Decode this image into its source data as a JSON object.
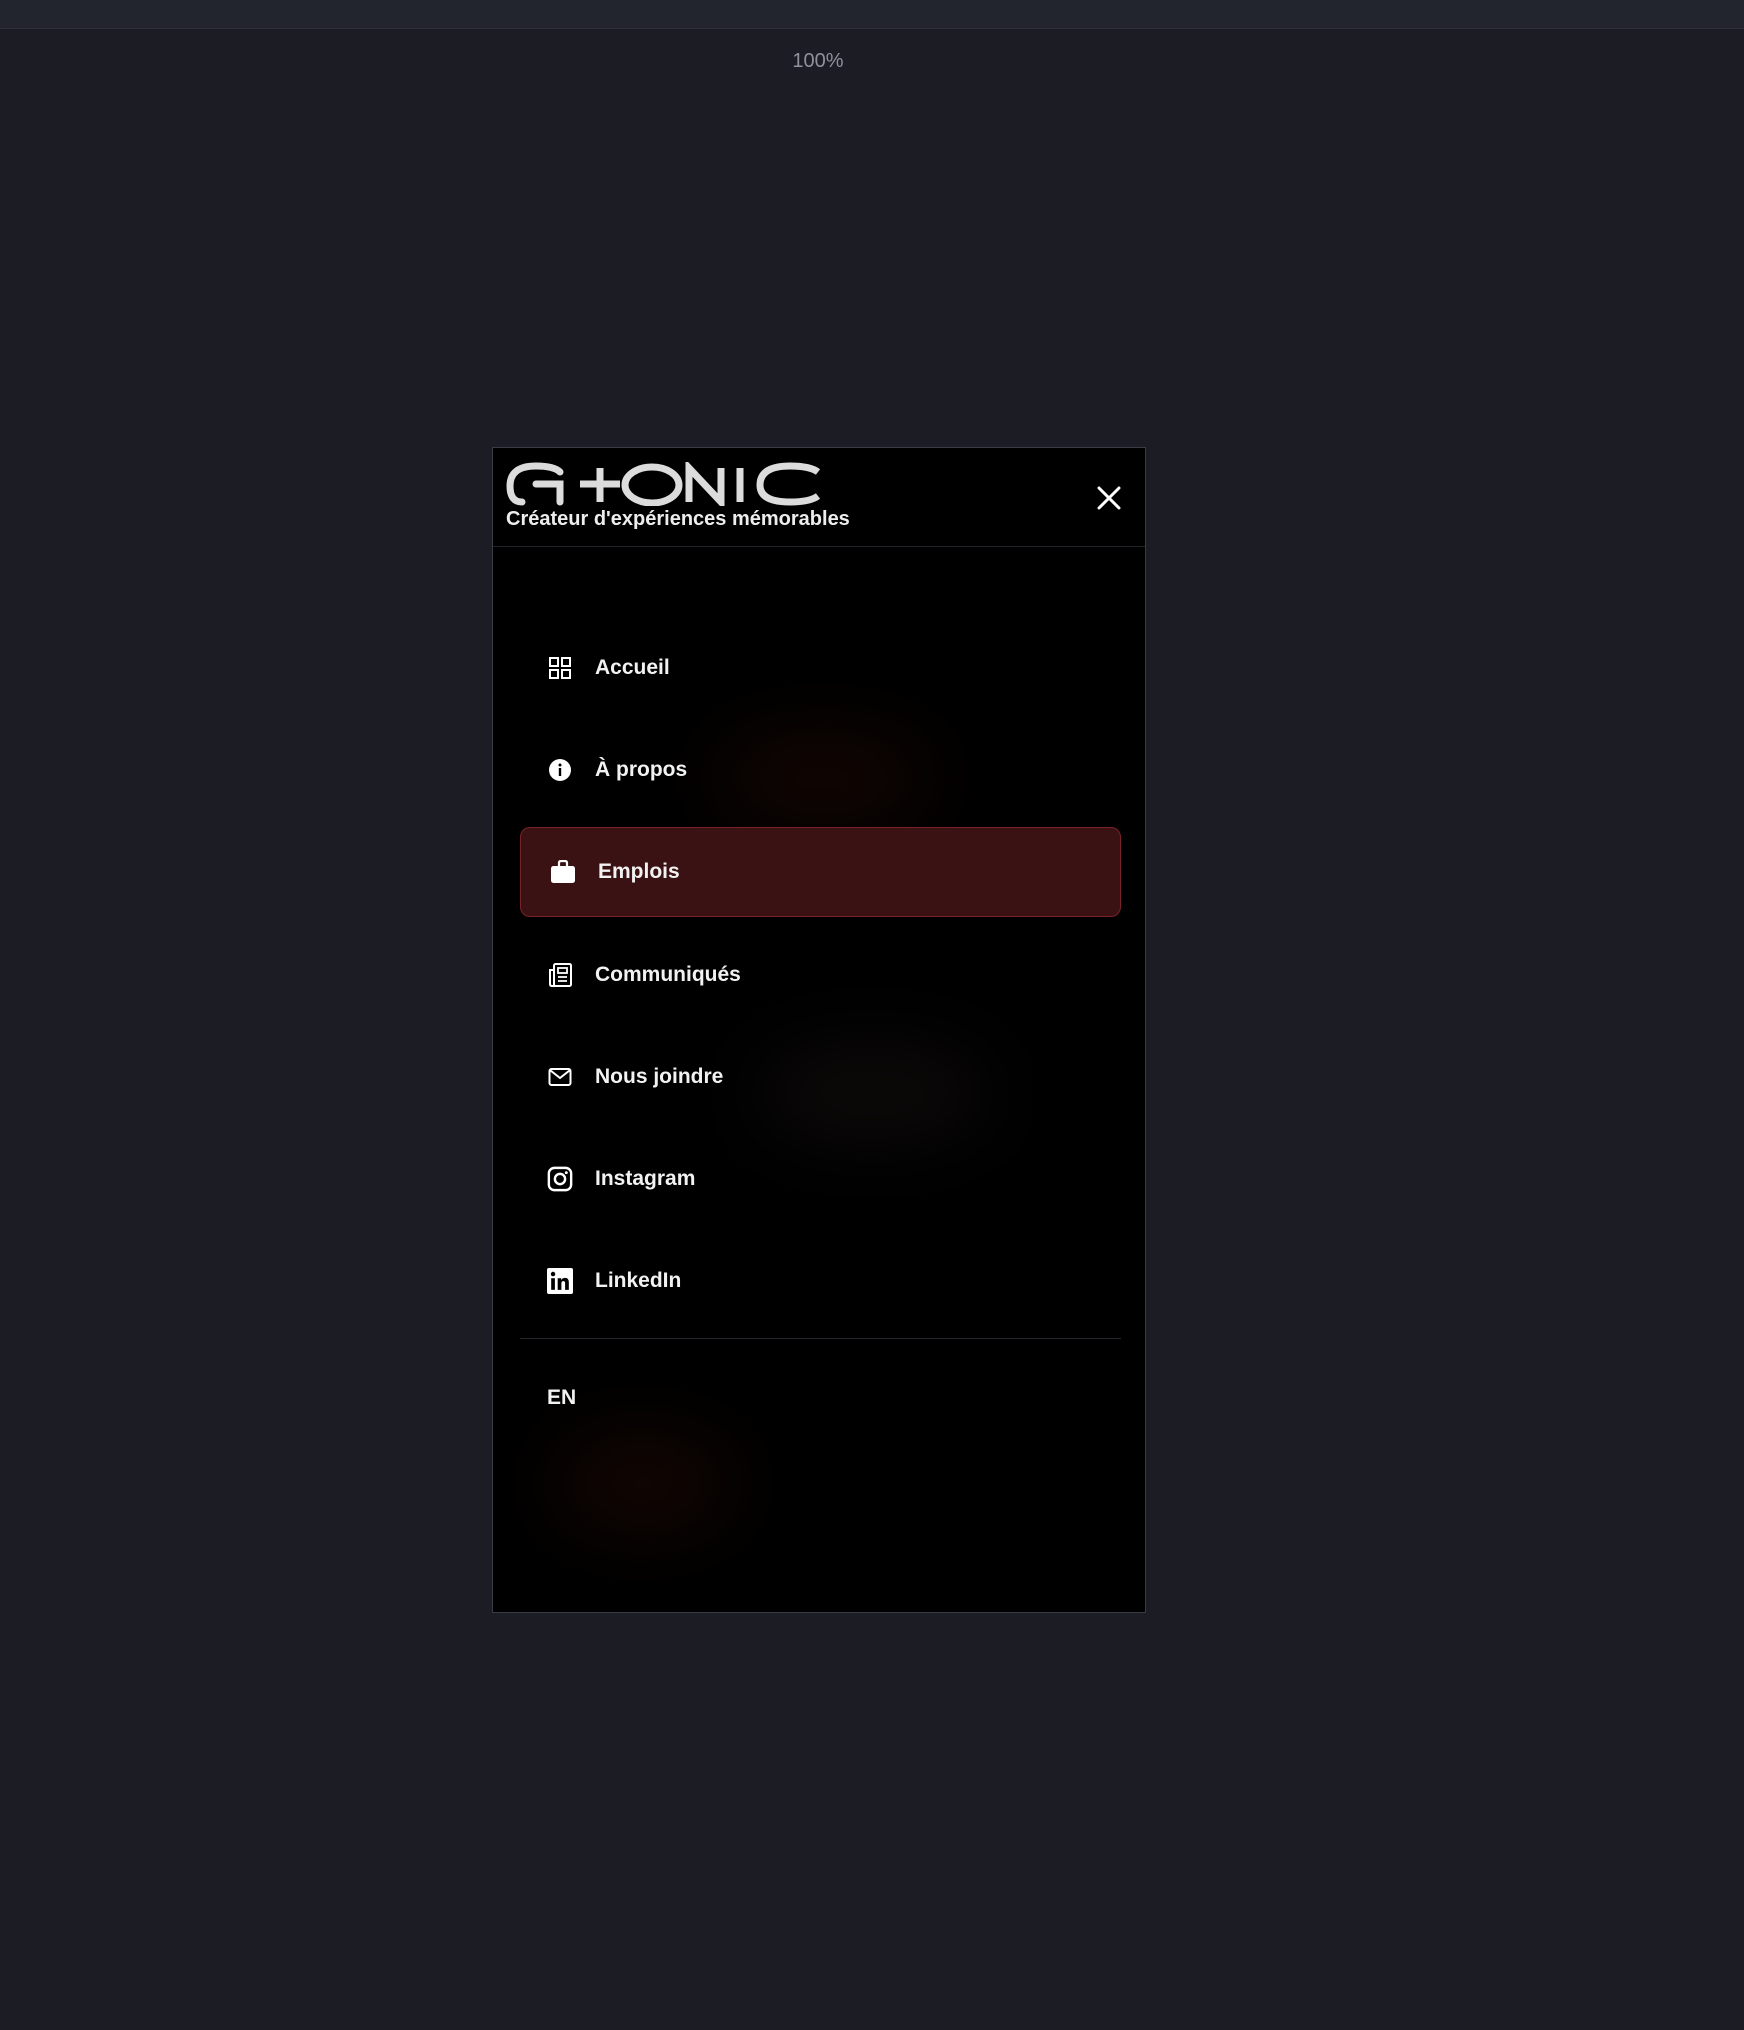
{
  "viewer": {
    "zoom": "100%"
  },
  "brand": {
    "logo_text": "GTONIC",
    "tagline": "Créateur d'expériences mémorables"
  },
  "menu": {
    "items": [
      {
        "label": "Accueil",
        "icon": "grid-icon",
        "active": false
      },
      {
        "label": "À propos",
        "icon": "info-icon",
        "active": false
      },
      {
        "label": "Emplois",
        "icon": "briefcase-icon",
        "active": true
      },
      {
        "label": "Communiqués",
        "icon": "newspaper-icon",
        "active": false
      },
      {
        "label": "Nous joindre",
        "icon": "mail-icon",
        "active": false
      },
      {
        "label": "Instagram",
        "icon": "instagram-icon",
        "active": false
      },
      {
        "label": "LinkedIn",
        "icon": "linkedin-icon",
        "active": false
      }
    ],
    "language_toggle": "EN"
  },
  "colors": {
    "page_background": "#1b1c24",
    "menu_background": "#000000",
    "active_background": "#3a1214",
    "active_border": "#7a2127",
    "text": "#f2f2f2"
  }
}
